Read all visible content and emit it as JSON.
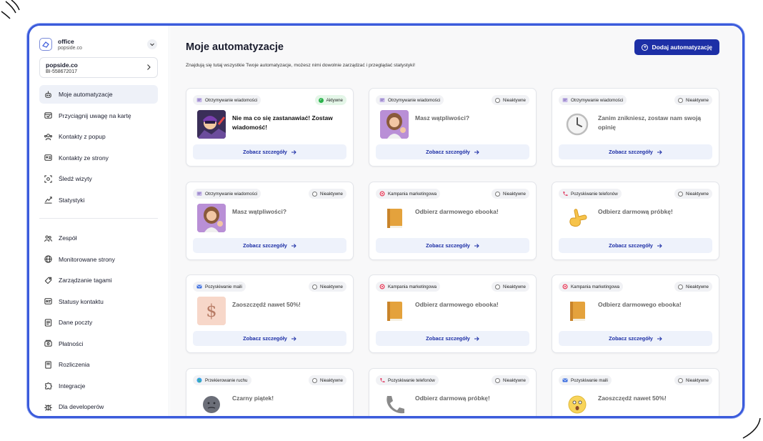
{
  "sidebar": {
    "org_name": "office",
    "org_domain": "popside.co",
    "site_name": "popside.co",
    "site_id": "BI-558672017",
    "nav_top": [
      {
        "label": "Moje automatyzacje",
        "icon": "robot-icon",
        "active": true
      },
      {
        "label": "Przyciągnij uwagę na kartę",
        "icon": "tab-attention-icon"
      },
      {
        "label": "Kontakty z popup",
        "icon": "popup-contacts-icon"
      },
      {
        "label": "Kontakty ze strony",
        "icon": "page-contacts-icon"
      },
      {
        "label": "Śledź wizyty",
        "icon": "track-visits-icon"
      },
      {
        "label": "Statystyki",
        "icon": "chart-icon"
      }
    ],
    "nav_bottom": [
      {
        "label": "Zespół",
        "icon": "team-icon"
      },
      {
        "label": "Monitorowane strony",
        "icon": "globe-icon"
      },
      {
        "label": "Zarządzanie tagami",
        "icon": "tag-icon"
      },
      {
        "label": "Statusy kontaktu",
        "icon": "contact-status-icon"
      },
      {
        "label": "Dane poczty",
        "icon": "mail-data-icon"
      },
      {
        "label": "Płatności",
        "icon": "payments-icon"
      },
      {
        "label": "Rozliczenia",
        "icon": "billing-icon"
      },
      {
        "label": "Integracje",
        "icon": "puzzle-icon"
      },
      {
        "label": "Dla developerów",
        "icon": "bug-icon"
      }
    ]
  },
  "main": {
    "title": "Moje automatyzacje",
    "subtitle": "Znajdują się tutaj wszystkie Twoje automatyzacje, możesz nimi dowolnie zarządzać i przeglądać statystyki!",
    "add_button": "Dodaj automatyzację",
    "details_label": "Zobacz szczegóły",
    "cards": [
      {
        "category": "Otrzymywanie wiadomości",
        "cat_icon": "message-icon",
        "status": "Aktywne",
        "active": true,
        "message": "Nie ma co się zastanawiać! Zostaw wiadomość!",
        "thumb": "superhero-thumb",
        "thumb_bg": "#3a2e58"
      },
      {
        "category": "Otrzymywanie wiadomości",
        "cat_icon": "message-icon",
        "status": "Nieaktywne",
        "active": false,
        "message": "Masz wątpliwości?",
        "thumb": "woman-thumb",
        "thumb_bg": "#b98fd6"
      },
      {
        "category": "Otrzymywanie wiadomości",
        "cat_icon": "message-icon",
        "status": "Nieaktywne",
        "active": false,
        "message": "Zanim znikniesz, zostaw nam swoją opinię",
        "thumb": "clock-thumb",
        "thumb_bg": "transparent"
      },
      {
        "category": "Otrzymywanie wiadomości",
        "cat_icon": "message-icon",
        "status": "Nieaktywne",
        "active": false,
        "message": "Masz wątpliwości?",
        "thumb": "woman-thumb",
        "thumb_bg": "#b98fd6"
      },
      {
        "category": "Kampania marketingowa",
        "cat_icon": "target-icon",
        "status": "Nieaktywne",
        "active": false,
        "message": "Odbierz darmowego ebooka!",
        "thumb": "book-thumb",
        "thumb_bg": "transparent"
      },
      {
        "category": "Pozyskiwanie telefonów",
        "cat_icon": "phone-icon",
        "status": "Nieaktywne",
        "active": false,
        "message": "Odbierz darmową próbkę!",
        "thumb": "call-hand-thumb",
        "thumb_bg": "transparent"
      },
      {
        "category": "Pozyskiwanie maili",
        "cat_icon": "mail-icon",
        "status": "Nieaktywne",
        "active": false,
        "message": "Zaoszczędź nawet 50%!",
        "thumb": "dollar-thumb",
        "thumb_bg": "#f7d7c9"
      },
      {
        "category": "Kampania marketingowa",
        "cat_icon": "target-icon",
        "status": "Nieaktywne",
        "active": false,
        "message": "Odbierz darmowego ebooka!",
        "thumb": "book-thumb",
        "thumb_bg": "transparent"
      },
      {
        "category": "Kampania marketingowa",
        "cat_icon": "target-icon",
        "status": "Nieaktywne",
        "active": false,
        "message": "Odbierz darmowego ebooka!",
        "thumb": "book-thumb",
        "thumb_bg": "transparent"
      },
      {
        "category": "Przekierowanie ruchu",
        "cat_icon": "globe-icon",
        "status": "Nieaktywne",
        "active": false,
        "message": "Czarny piątek!",
        "thumb": "dark-face-thumb",
        "thumb_bg": "transparent"
      },
      {
        "category": "Pozyskiwanie telefonów",
        "cat_icon": "phone-icon",
        "status": "Nieaktywne",
        "active": false,
        "message": "Odbierz darmową próbkę!",
        "thumb": "telephone-thumb",
        "thumb_bg": "transparent"
      },
      {
        "category": "Pozyskiwanie maili",
        "cat_icon": "mail-icon",
        "status": "Nieaktywne",
        "active": false,
        "message": "Zaoszczędź nawet 50%!",
        "thumb": "wow-face-thumb",
        "thumb_bg": "transparent"
      }
    ]
  },
  "colors": {
    "accent": "#1d2fa6",
    "frame": "#3b5bdb",
    "active_status": "#2bb24c"
  }
}
